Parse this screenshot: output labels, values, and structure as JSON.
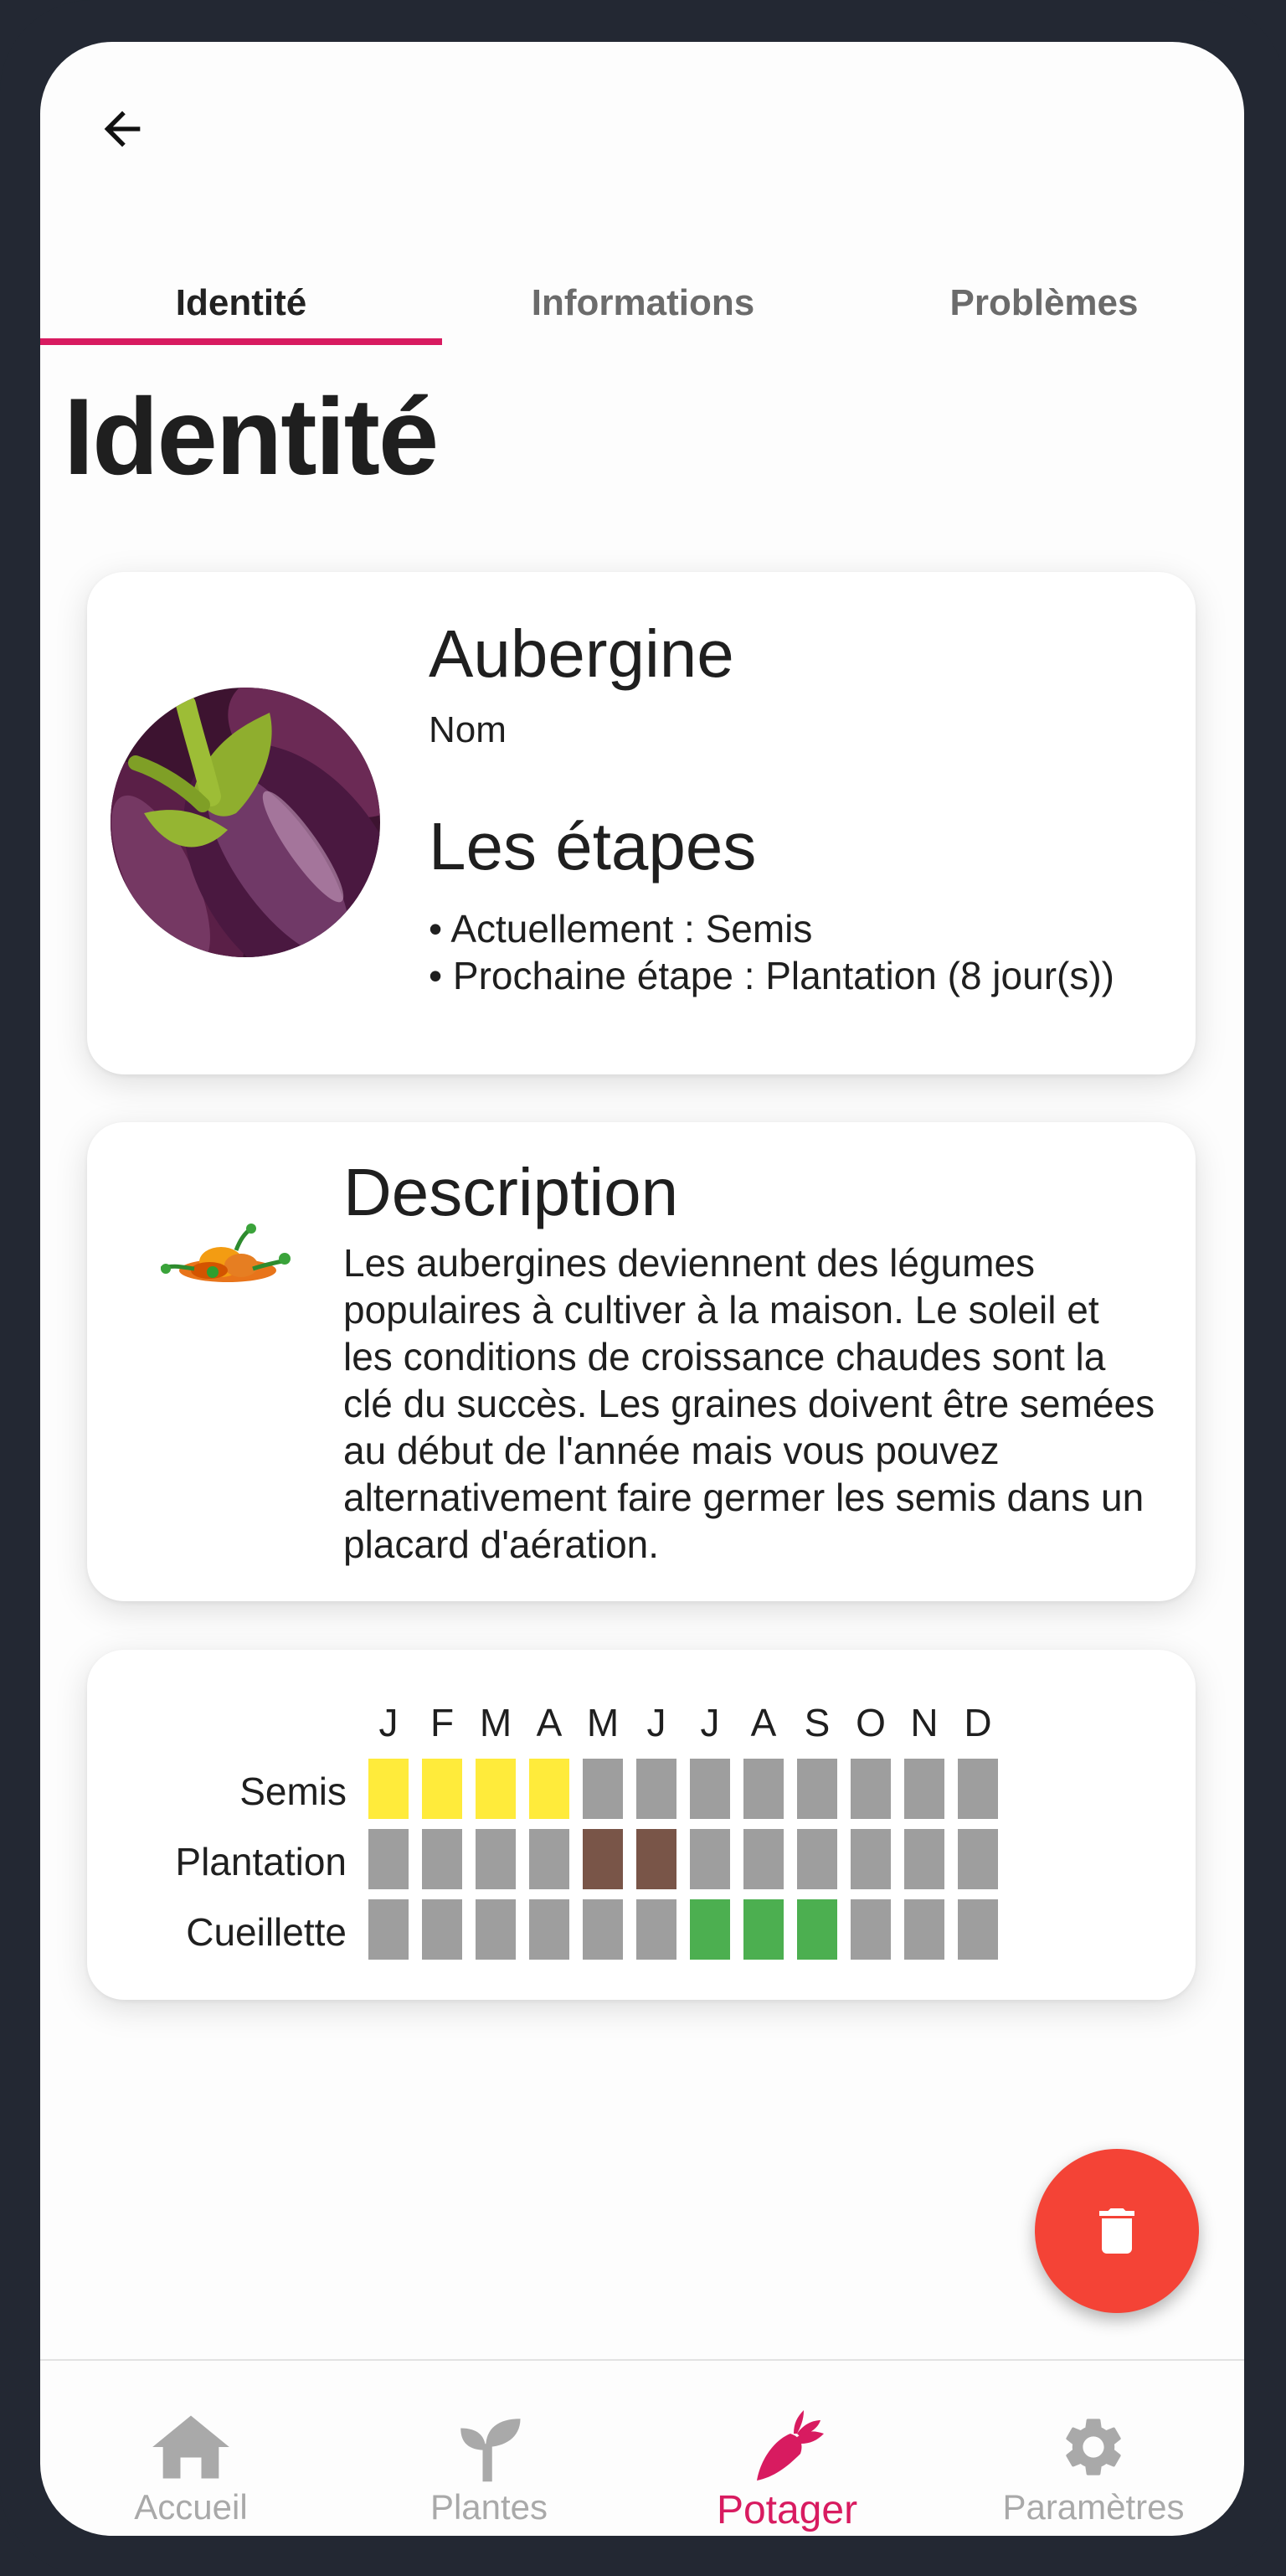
{
  "tabs": [
    {
      "label": "Identité"
    },
    {
      "label": "Informations"
    },
    {
      "label": "Problèmes"
    }
  ],
  "active_tab": 0,
  "page_title": "Identité",
  "identity_card": {
    "name_value": "Aubergine",
    "name_label": "Nom",
    "steps_title": "Les étapes",
    "steps": [
      "• Actuellement : Semis",
      "• Prochaine étape : Plantation (8 jour(s))"
    ],
    "photo_icon": "eggplant-photo"
  },
  "description_card": {
    "icon": "vegetables-icon",
    "title": "Description",
    "text": "Les aubergines deviennent des légumes populaires à cultiver à la maison. Le soleil et les conditions de croissance chaudes sont la clé du succès. Les graines doivent être semées au début de l'année mais vous pouvez alternativement faire germer les semis dans un placard d'aération."
  },
  "calendar": {
    "months": [
      "J",
      "F",
      "M",
      "A",
      "M",
      "J",
      "J",
      "A",
      "S",
      "O",
      "N",
      "D"
    ],
    "rows": [
      {
        "label": "Semis",
        "color": "#ffeb3b",
        "active_months": [
          1,
          2,
          3,
          4
        ]
      },
      {
        "label": "Plantation",
        "color": "#795548",
        "active_months": [
          5,
          6
        ]
      },
      {
        "label": "Cueillette",
        "color": "#4caf50",
        "active_months": [
          7,
          8,
          9
        ]
      }
    ],
    "inactive_color": "#9e9e9e"
  },
  "fab": {
    "icon": "trash-icon",
    "color": "#f44336"
  },
  "bottom_nav": [
    {
      "label": "Accueil",
      "icon": "home-icon"
    },
    {
      "label": "Plantes",
      "icon": "sprout-icon"
    },
    {
      "label": "Potager",
      "icon": "carrot-icon"
    },
    {
      "label": "Paramètres",
      "icon": "gear-icon"
    }
  ],
  "active_nav": 2,
  "colors": {
    "accent": "#d81b60",
    "frame": "#232833"
  }
}
